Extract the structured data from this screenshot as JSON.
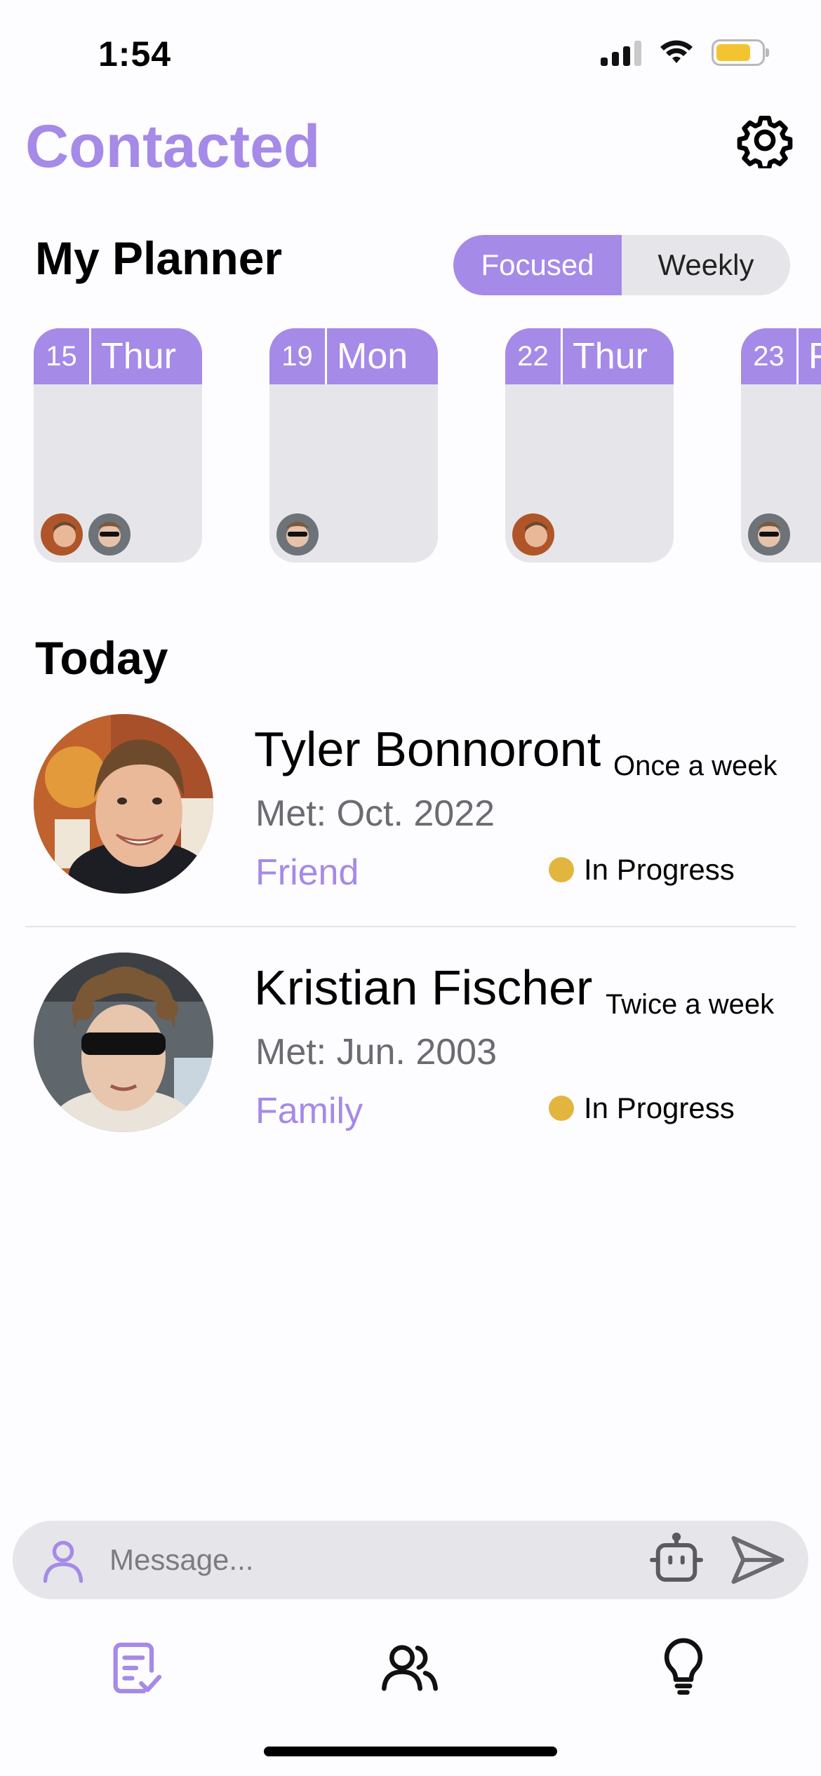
{
  "status_bar": {
    "time": "1:54"
  },
  "header": {
    "title": "Contacted"
  },
  "planner": {
    "title": "My Planner",
    "modes": [
      "Focused",
      "Weekly"
    ],
    "active_mode": "Focused",
    "days": [
      {
        "num": "15",
        "name": "Thur",
        "avatars": [
          "tyler",
          "kristian"
        ]
      },
      {
        "num": "19",
        "name": "Mon",
        "avatars": [
          "kristian"
        ]
      },
      {
        "num": "22",
        "name": "Thur",
        "avatars": [
          "tyler"
        ]
      },
      {
        "num": "23",
        "name": "Fri",
        "avatars": [
          "kristian"
        ]
      }
    ]
  },
  "today": {
    "title": "Today",
    "contacts": [
      {
        "name": "Tyler Bonnoront",
        "frequency": "Once a week",
        "met": "Met: Oct. 2022",
        "relationship": "Friend",
        "status": "In Progress"
      },
      {
        "name": "Kristian Fischer",
        "frequency": "Twice a week",
        "met": "Met: Jun. 2003",
        "relationship": "Family",
        "status": "In Progress"
      }
    ]
  },
  "message_bar": {
    "placeholder": "Message..."
  },
  "colors": {
    "accent": "#a58ae8",
    "card": "#e6e6ea",
    "status_dot": "#e2b53e"
  },
  "icons": [
    "gear-icon",
    "person-icon",
    "robot-icon",
    "send-icon",
    "checklist-icon",
    "people-icon",
    "lightbulb-icon"
  ]
}
